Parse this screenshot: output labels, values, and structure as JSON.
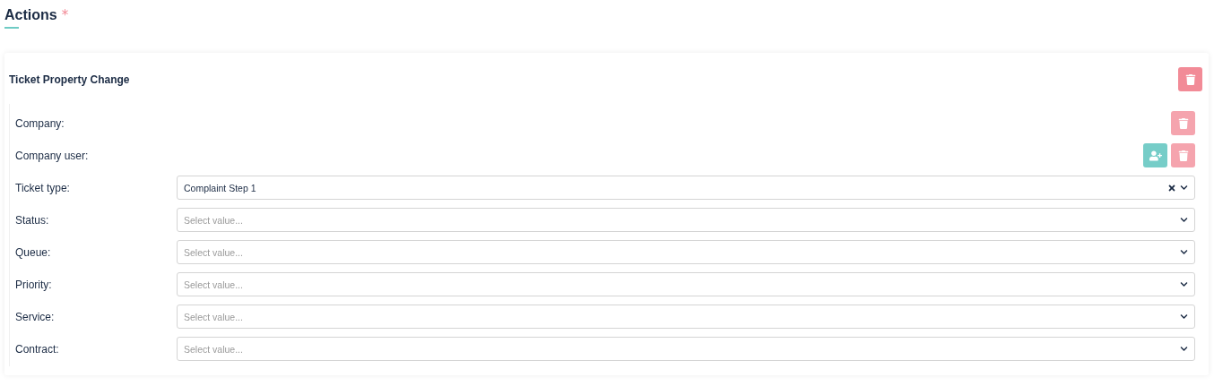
{
  "section": {
    "title": "Actions",
    "required_mark": "*"
  },
  "action": {
    "title": "Ticket Property Change",
    "rows": [
      {
        "kind": "buttons",
        "label": "Company:",
        "buttons": [
          {
            "kind": "delete"
          }
        ]
      },
      {
        "kind": "buttons",
        "label": "Company user:",
        "buttons": [
          {
            "kind": "add-user"
          },
          {
            "kind": "delete"
          }
        ]
      },
      {
        "kind": "select",
        "label": "Ticket type:",
        "value": "Complaint Step 1",
        "clearable": true
      },
      {
        "kind": "select",
        "label": "Status:",
        "placeholder": "Select value...",
        "clearable": false
      },
      {
        "kind": "select",
        "label": "Queue:",
        "placeholder": "Select value...",
        "clearable": false
      },
      {
        "kind": "select",
        "label": "Priority:",
        "placeholder": "Select value...",
        "clearable": false
      },
      {
        "kind": "select",
        "label": "Service:",
        "placeholder": "Select value...",
        "clearable": false
      },
      {
        "kind": "select",
        "label": "Contract:",
        "placeholder": "Select value...",
        "clearable": false
      }
    ]
  }
}
